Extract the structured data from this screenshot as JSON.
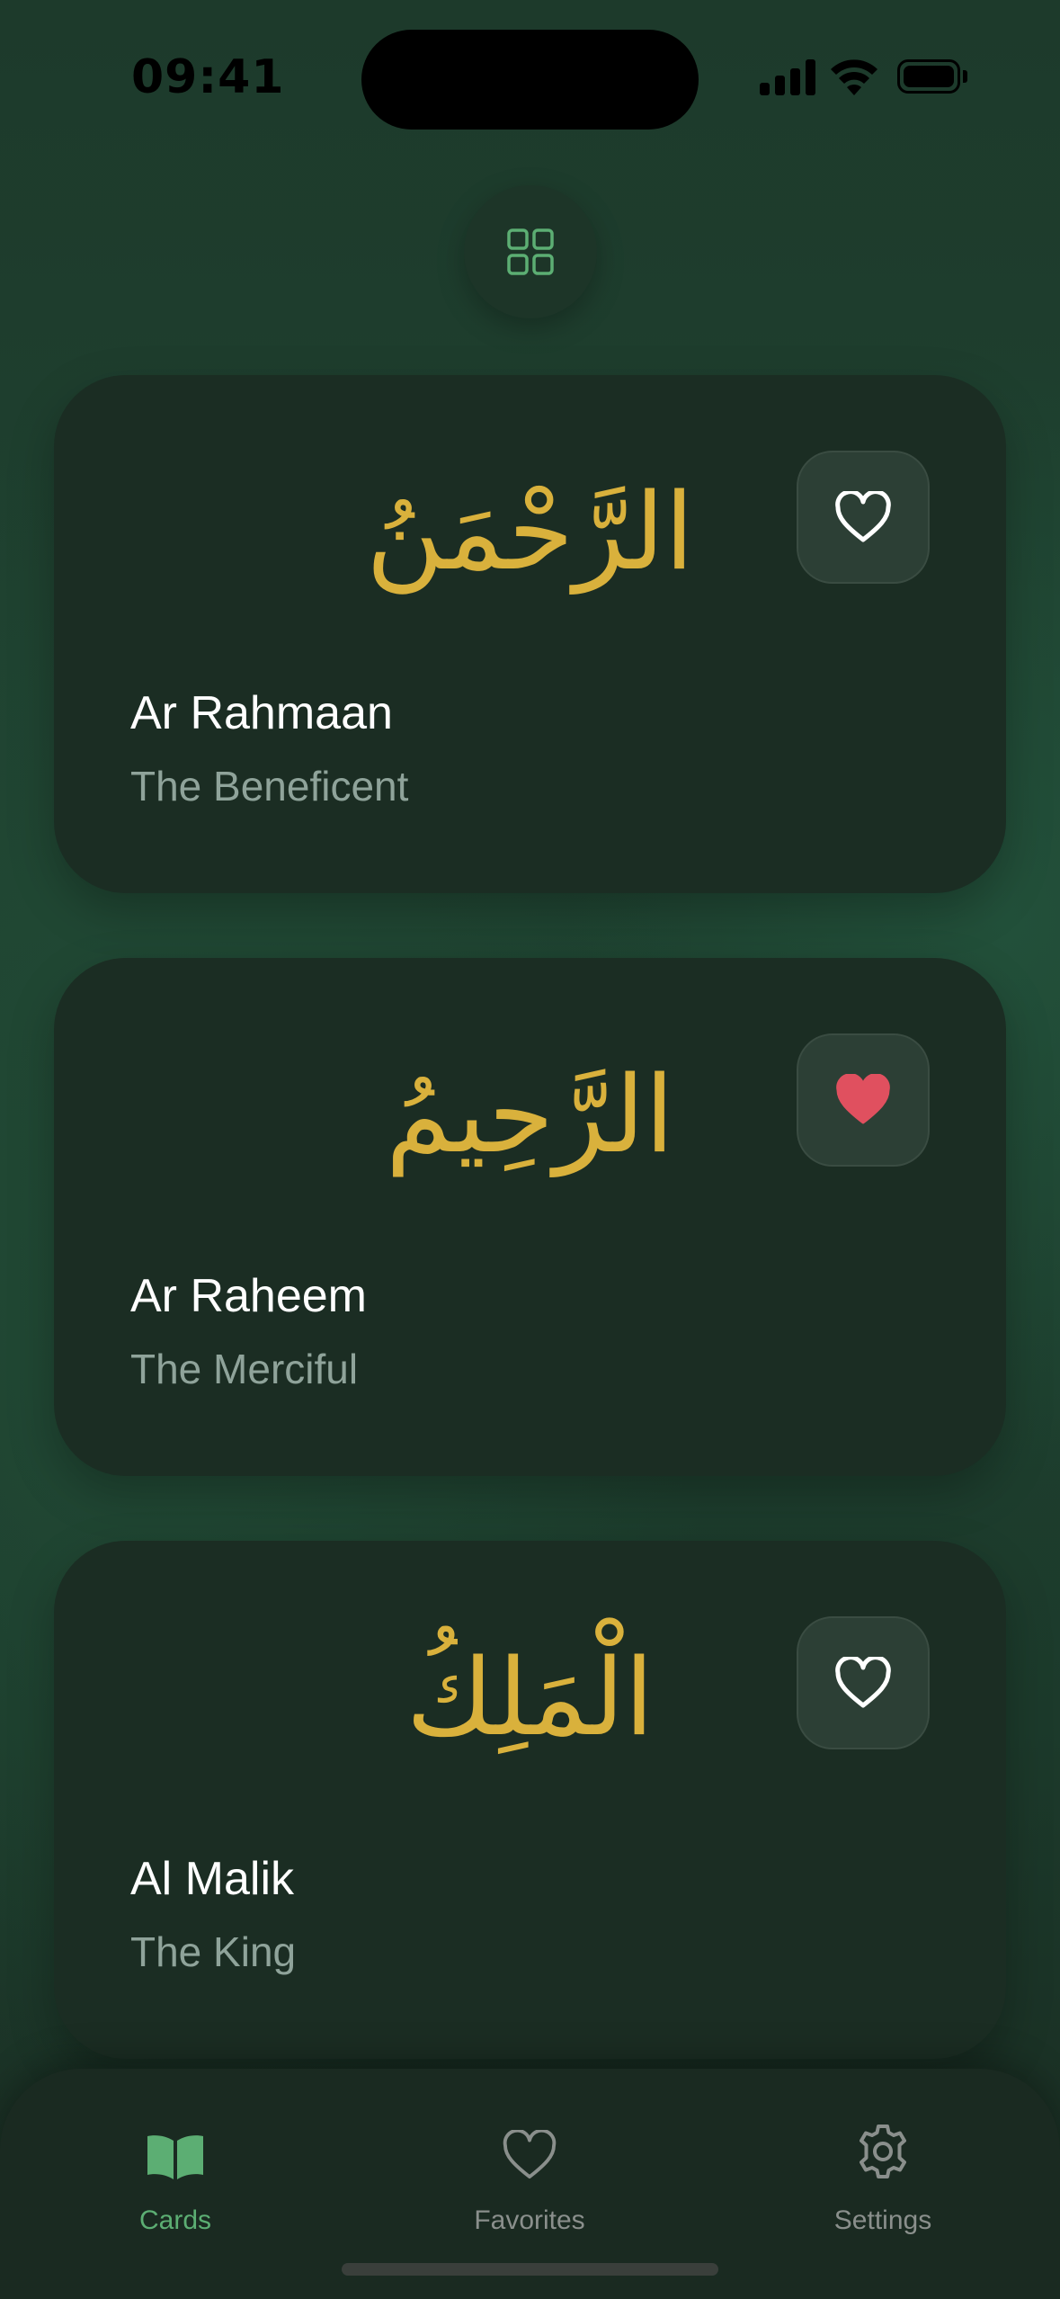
{
  "status_bar": {
    "time": "09:41"
  },
  "toolbar": {
    "view_toggle_icon": "grid-icon"
  },
  "colors": {
    "background": "#1f4331",
    "card": "#1b2d23",
    "arabic_gold": "#d9b13c",
    "accent_green": "#5cae73",
    "favorite_red": "#e0505f",
    "muted_text": "#8fa39a"
  },
  "cards": [
    {
      "arabic": "الرَّحْمَنُ",
      "name": "Ar Rahmaan",
      "meaning": "The Beneficent",
      "favorited": false
    },
    {
      "arabic": "الرَّحِيمُ",
      "name": "Ar Raheem",
      "meaning": "The Merciful",
      "favorited": true
    },
    {
      "arabic": "الْمَلِكُ",
      "name": "Al Malik",
      "meaning": "The King",
      "favorited": false
    }
  ],
  "tab_bar": {
    "items": [
      {
        "label": "Cards",
        "icon": "book-icon",
        "active": true
      },
      {
        "label": "Favorites",
        "icon": "heart-icon",
        "active": false
      },
      {
        "label": "Settings",
        "icon": "gear-icon",
        "active": false
      }
    ]
  }
}
